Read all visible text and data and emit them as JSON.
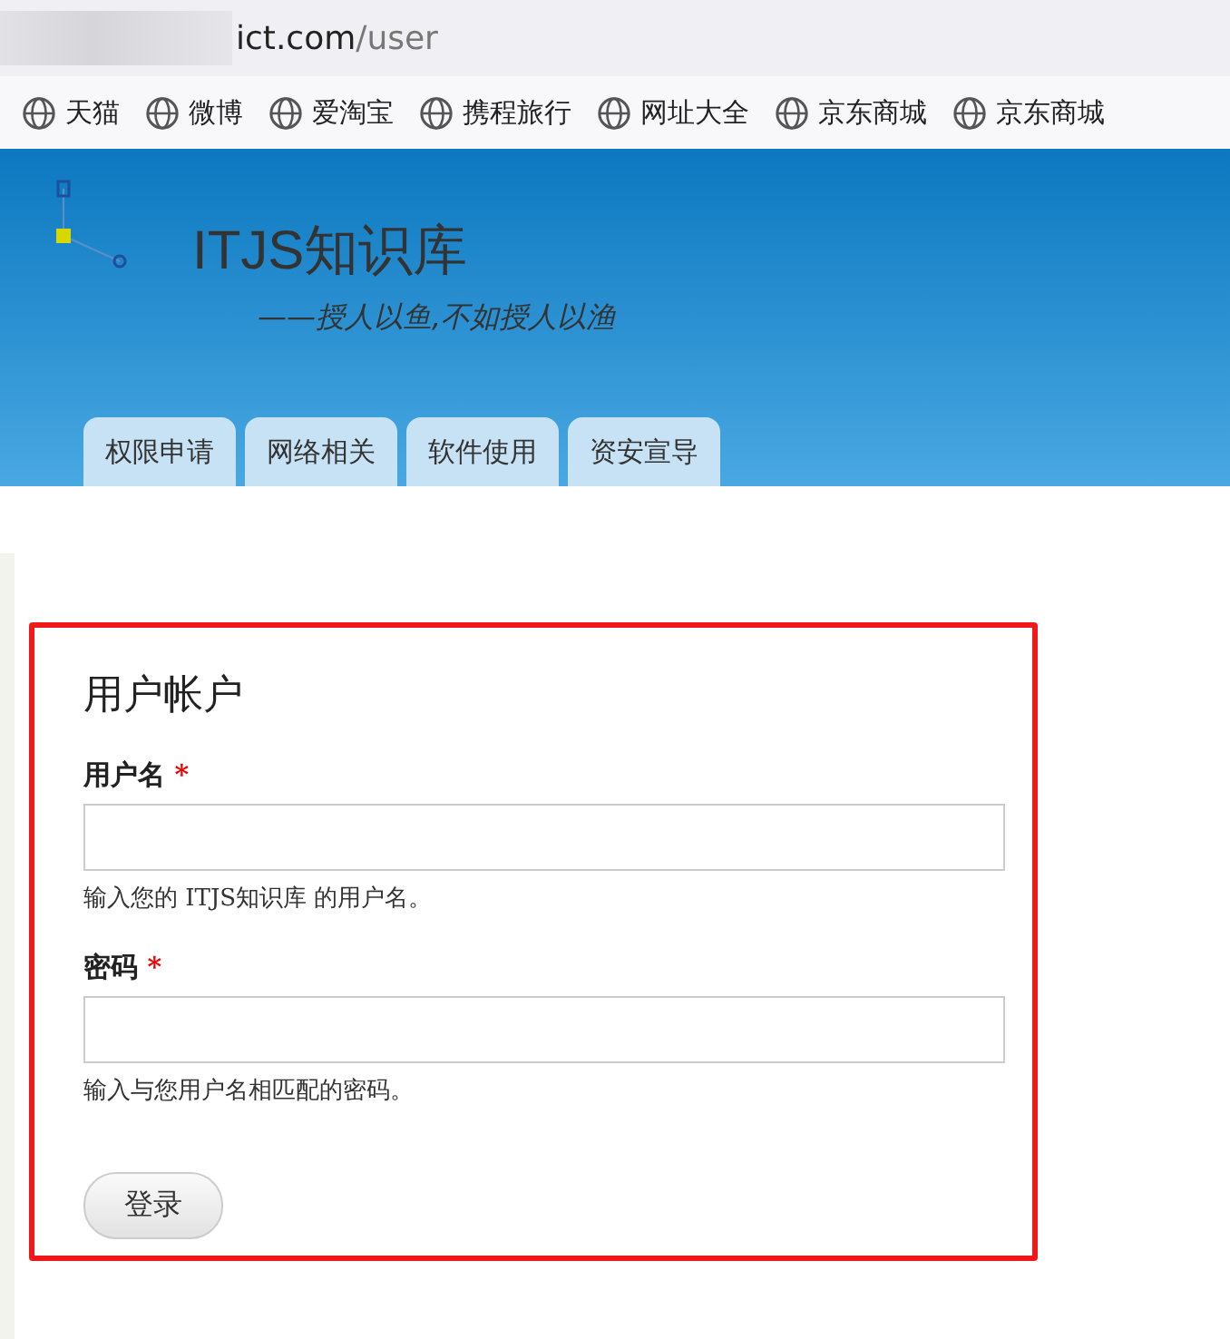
{
  "address_bar": {
    "host": "ict.com",
    "path": "/user"
  },
  "bookmarks": [
    {
      "label": "天猫"
    },
    {
      "label": "微博"
    },
    {
      "label": "爱淘宝"
    },
    {
      "label": "携程旅行"
    },
    {
      "label": "网址大全"
    },
    {
      "label": "京东商城"
    },
    {
      "label": "京东商城"
    }
  ],
  "header": {
    "site_name": "ITJS知识库",
    "slogan": "——授人以鱼,不如授人以渔"
  },
  "nav_tabs": [
    {
      "label": "权限申请"
    },
    {
      "label": "网络相关"
    },
    {
      "label": "软件使用"
    },
    {
      "label": "资安宣导"
    }
  ],
  "login_form": {
    "title": "用户帐户",
    "fields": [
      {
        "label": "用户名",
        "required_mark": "*",
        "description": "输入您的 ITJS知识库 的用户名。"
      },
      {
        "label": "密码",
        "required_mark": "*",
        "description": "输入与您用户名相匹配的密码。"
      }
    ],
    "submit_button": "登录"
  }
}
